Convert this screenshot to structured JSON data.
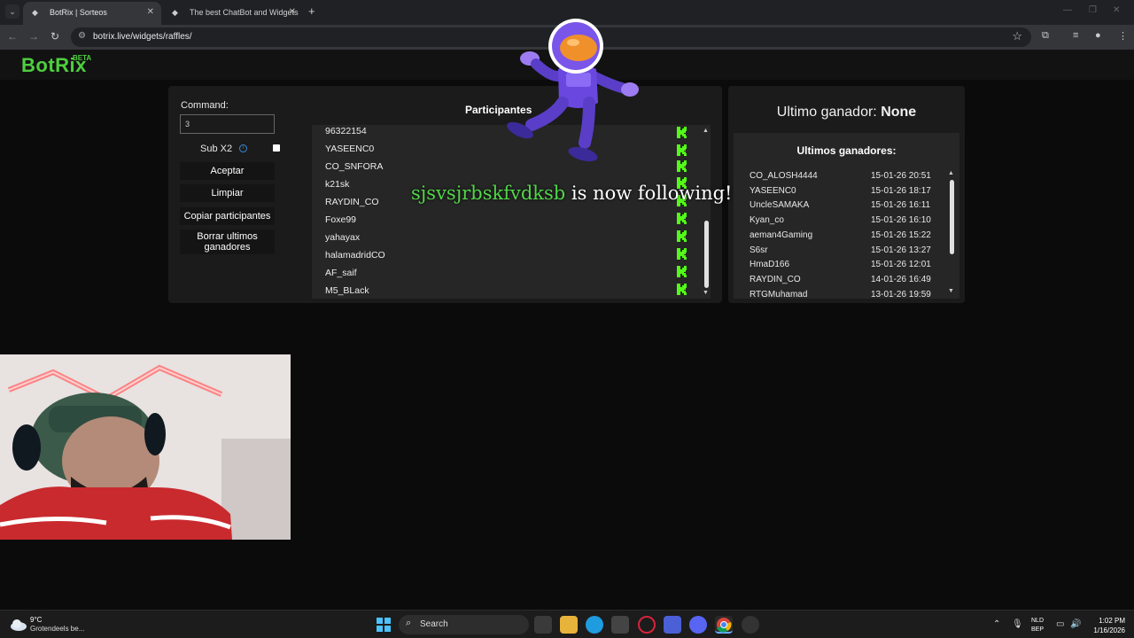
{
  "browser": {
    "tabs": [
      {
        "label": "BotRix | Sorteos",
        "active": true
      },
      {
        "label": "The best ChatBot and Widgets",
        "active": false
      }
    ],
    "url": "botrix.live/widgets/raffles/"
  },
  "app": {
    "logo": "BotRix",
    "beta": "BETA",
    "accent": "#4ecf3f"
  },
  "controls": {
    "command_label": "Command:",
    "command_value": "3",
    "sub_label": "Sub X2",
    "buttons": {
      "accept": "Aceptar",
      "clear": "Limpiar",
      "copy": "Copiar participantes",
      "delete_winners": "Borrar ultimos ganadores"
    }
  },
  "participants": {
    "title": "Participantes",
    "list": [
      "96322154",
      "YASEENC0",
      "CO_SNFORA",
      "k21sk",
      "RAYDIN_CO",
      "Foxe99",
      "yahayax",
      "halamadridCO",
      "AF_saif",
      "M5_BLack"
    ]
  },
  "winners": {
    "last_winner_label": "Ultimo ganador:",
    "last_winner_value": "None",
    "title": "Ultimos ganadores:",
    "list": [
      {
        "name": "CO_ALOSH4444",
        "date": "15-01-26 20:51"
      },
      {
        "name": "YASEENC0",
        "date": "15-01-26 18:17"
      },
      {
        "name": "UncleSAMAKA",
        "date": "15-01-26 16:11"
      },
      {
        "name": "Kyan_co",
        "date": "15-01-26 16:10"
      },
      {
        "name": "aeman4Gaming",
        "date": "15-01-26 15:22"
      },
      {
        "name": "S6sr",
        "date": "15-01-26 13:27"
      },
      {
        "name": "HmaD166",
        "date": "15-01-26 12:01"
      },
      {
        "name": "RAYDIN_CO",
        "date": "14-01-26 16:49"
      },
      {
        "name": "RTGMuhamad",
        "date": "13-01-26 19:59"
      }
    ]
  },
  "alert": {
    "username": "sjsvsjrbskfvdksb",
    "message": "is now following!"
  },
  "taskbar": {
    "weather_temp": "9°C",
    "weather_desc": "Grotendeels be...",
    "search": "Search",
    "lang_1": "NLD",
    "lang_2": "BEP",
    "time": "1:02 PM",
    "date": "1/16/2026"
  }
}
